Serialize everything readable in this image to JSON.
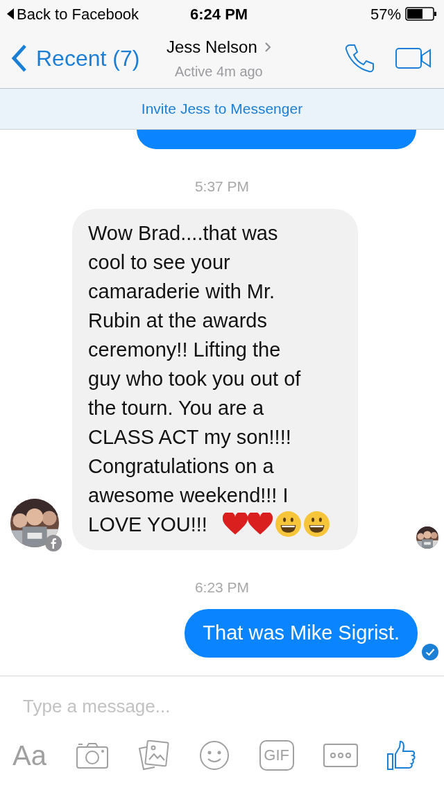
{
  "status_bar": {
    "back_label": "Back to Facebook",
    "time": "6:24 PM",
    "battery": "57%"
  },
  "header": {
    "back_label": "Recent (7)",
    "contact_name": "Jess Nelson",
    "presence": "Active 4m ago"
  },
  "invite_banner": "Invite Jess to Messenger",
  "messages": [
    {
      "kind": "cutoff_outgoing"
    },
    {
      "kind": "timestamp",
      "text": "5:37 PM"
    },
    {
      "kind": "incoming",
      "lines": [
        "Wow Brad....that was",
        "cool to see your",
        "camaraderie with Mr.",
        "Rubin at the awards",
        "ceremony!!   Lifting the",
        "guy who took you out of",
        "the tourn.  You are a",
        "CLASS ACT my son!!!!",
        "Congratulations on a",
        "awesome weekend!!!  I",
        "LOVE YOU!!!"
      ],
      "emojis": [
        {
          "kind": "heart"
        },
        {
          "kind": "heart"
        },
        {
          "kind": "smiley"
        },
        {
          "kind": "smiley"
        }
      ]
    },
    {
      "kind": "timestamp",
      "text": "6:23 PM"
    },
    {
      "kind": "outgoing",
      "text": "That was Mike Sigrist.",
      "delivered": true
    }
  ],
  "composer": {
    "placeholder": "Type a message...",
    "tools": [
      {
        "kind": "text",
        "label": "Aa"
      },
      {
        "kind": "camera"
      },
      {
        "kind": "photos"
      },
      {
        "kind": "emoji"
      },
      {
        "kind": "gif",
        "label": "GIF"
      },
      {
        "kind": "more"
      },
      {
        "kind": "like"
      }
    ]
  }
}
